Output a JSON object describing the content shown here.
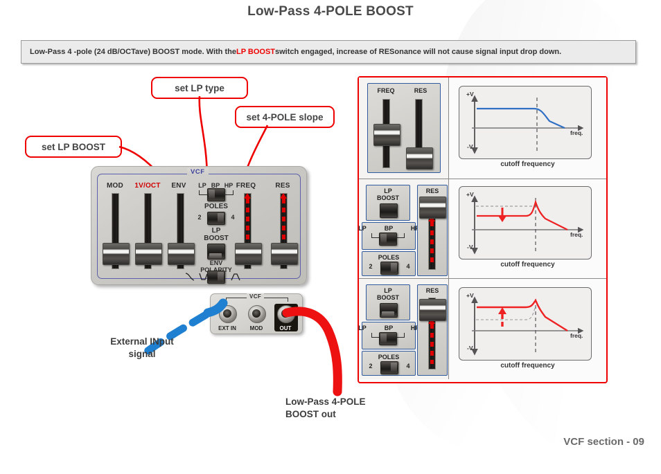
{
  "title": "Low-Pass 4-POLE BOOST",
  "description": {
    "before": "Low-Pass 4 -pole (24 dB/OCTave) BOOST mode. With the ",
    "highlight": "LP BOOST",
    "after": " switch engaged, increase of RESonance will not cause signal input drop down."
  },
  "callouts": [
    {
      "id": "lp-boost",
      "label": "set LP BOOST"
    },
    {
      "id": "lp-type",
      "label": "set LP type"
    },
    {
      "id": "four-pole",
      "label": "set 4-POLE slope"
    }
  ],
  "synth_panel": {
    "section_tag": "VCF",
    "sliders": [
      {
        "name": "MOD",
        "red": false,
        "position": "bottom"
      },
      {
        "name": "1V/OCT",
        "red": true,
        "position": "bottom"
      },
      {
        "name": "ENV",
        "red": false,
        "position": "bottom"
      },
      {
        "name": "FREQ",
        "red": false,
        "position": "bottom",
        "arrow": "up"
      },
      {
        "name": "RES",
        "red": false,
        "position": "bottom",
        "arrow": "up"
      }
    ],
    "filter_type": {
      "options": [
        "LP",
        "BP",
        "HP"
      ],
      "selected": "LP"
    },
    "poles": {
      "label": "POLES",
      "options": [
        "2",
        "4"
      ],
      "selected": "4"
    },
    "lp_boost": {
      "line1": "LP",
      "line2": "BOOST",
      "state": "engaged"
    },
    "env_polarity": {
      "line1": "ENV",
      "line2": "POLARITY"
    }
  },
  "jack_panel": {
    "section_tag": "VCF",
    "jacks": [
      {
        "label": "EXT IN",
        "highlight": false,
        "cable": "blue"
      },
      {
        "label": "MOD",
        "highlight": false,
        "cable": "none"
      },
      {
        "label": "OUT",
        "highlight": true,
        "cable": "red"
      }
    ]
  },
  "annotations": {
    "input_note": "External INput\nsignal",
    "input_note_line1": "External INput",
    "input_note_line2": "signal",
    "output_note_line1": "Low-Pass 4-POLE",
    "output_note_line2": "BOOST out"
  },
  "diagram_rows": [
    {
      "controls": [
        {
          "type": "slider",
          "label": "FREQ",
          "position": "middle"
        },
        {
          "type": "slider",
          "label": "RES",
          "position": "bottom"
        }
      ],
      "graph": {
        "curve_color": "#2f6fc4",
        "y_top": "+V",
        "y_bottom": "-V",
        "x_label": "freq.",
        "caption": "cutoff frequency",
        "resonance_peak": false,
        "arrow": "none"
      }
    },
    {
      "controls": [
        {
          "type": "switch",
          "label": "LP\nBOOST",
          "label1": "LP",
          "label2": "BOOST",
          "state": "off"
        },
        {
          "type": "switch",
          "label": "LP BP HP",
          "options": [
            "LP",
            "BP",
            "HP"
          ],
          "selected": "LP"
        },
        {
          "type": "switch",
          "label": "POLES",
          "options": [
            "2",
            "4"
          ],
          "selected": "4"
        },
        {
          "type": "slider",
          "label": "RES",
          "position": "top",
          "arrow": "up"
        }
      ],
      "graph": {
        "curve_color": "#ee2222",
        "y_top": "+V",
        "y_bottom": "-V",
        "x_label": "freq.",
        "caption": "cutoff frequency",
        "resonance_peak": true,
        "arrow": "down",
        "arrow_meaning": "signal level drops"
      }
    },
    {
      "controls": [
        {
          "type": "switch",
          "label": "LP\nBOOST",
          "label1": "LP",
          "label2": "BOOST",
          "state": "on"
        },
        {
          "type": "switch",
          "label": "LP BP HP",
          "options": [
            "LP",
            "BP",
            "HP"
          ],
          "selected": "LP"
        },
        {
          "type": "switch",
          "label": "POLES",
          "options": [
            "2",
            "4"
          ],
          "selected": "4"
        },
        {
          "type": "slider",
          "label": "RES",
          "position": "top",
          "arrow": "up"
        }
      ],
      "graph": {
        "curve_color": "#ee2222",
        "y_top": "+V",
        "y_bottom": "-V",
        "x_label": "freq.",
        "caption": "cutoff frequency",
        "resonance_peak": true,
        "arrow": "up",
        "arrow_meaning": "signal level restored"
      }
    }
  ],
  "footer": "VCF section - 09",
  "colors": {
    "accent_red": "#ee0000",
    "curve_blue": "#2f6fc4",
    "cable_blue": "#1f7fd0",
    "box_blue": "#2f5b9e"
  }
}
